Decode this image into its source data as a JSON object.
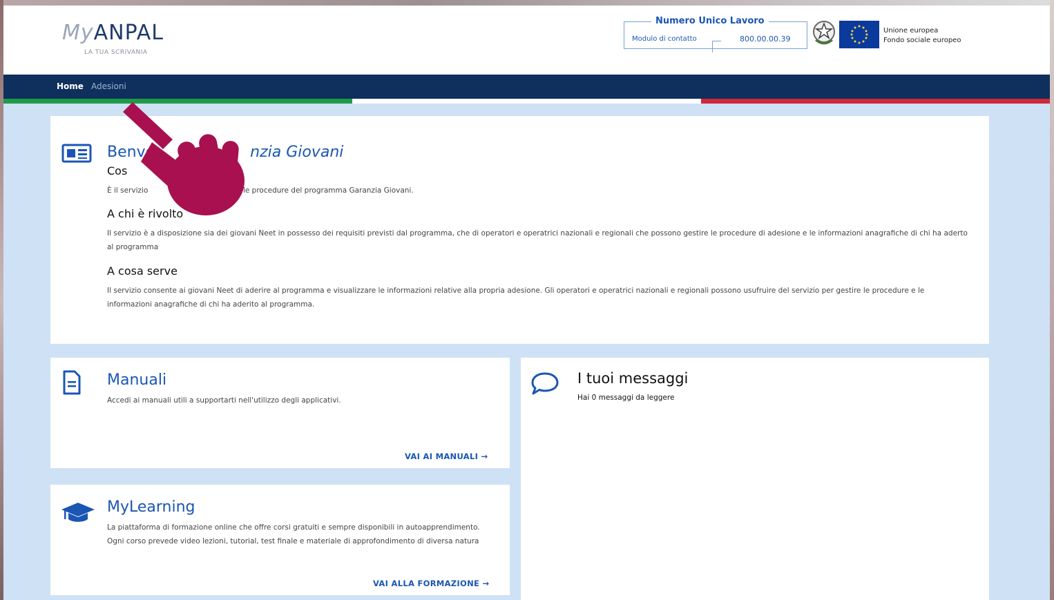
{
  "header": {
    "logo_main": "ANPAL",
    "logo_prefix": "My",
    "logo_subtitle": "LA TUA SCRIVANIA",
    "contact_title": "Numero Unico Lavoro",
    "contact_label": "Modulo di contatto",
    "contact_number": "800.00.00.39",
    "eu_line1": "Unione europea",
    "eu_line2": "Fondo sociale europeo"
  },
  "nav": {
    "home": "Home",
    "adesioni": "Adesioni"
  },
  "colors": {
    "navy": "#0f2f5c",
    "accent_blue": "#1a56b3",
    "background": "#cfe1f5",
    "flag_green": "#1f9a48",
    "flag_white": "#ffffff",
    "flag_red": "#d1283a",
    "cursor_hand": "#a8104f"
  },
  "welcome": {
    "title_visible_start": "Benve",
    "title_visible_end": "nzia Giovani",
    "section1_heading_visible": "Cos",
    "section1_text_start": "È il servizio",
    "section1_text_end": "zioni e le procedure del programma Garanzia Giovani.",
    "section2_heading": "A chi è rivolto",
    "section2_text": "Il servizio è a disposizione sia dei giovani Neet in possesso dei requisiti previsti dal programma, che di operatori e operatrici nazionali e regionali che possono gestire le procedure di adesione e le informazioni anagrafiche di chi ha aderto al programma",
    "section3_heading": "A cosa serve",
    "section3_text": "Il servizio consente ai giovani Neet di aderire al programma e visualizzare le informazioni relative alla propria adesione. Gli operatori e operatrici nazionali e regionali possono usufruire del servizio per gestire le procedure e le informazioni anagrafiche di chi ha aderito al programma."
  },
  "manuali": {
    "title": "Manuali",
    "text": "Accedi ai manuali utili a supportarti nell'utilizzo degli applicativi.",
    "cta": "VAI AI MANUALI →"
  },
  "messaggi": {
    "title": "I tuoi messaggi",
    "text": "Hai 0 messaggi da leggere"
  },
  "mylearning": {
    "title": "MyLearning",
    "text_line1": "La piattaforma di formazione online che offre corsi gratuiti e sempre disponibili in autoapprendimento.",
    "text_line2": "Ogni corso prevede video lezioni, tutorial, test finale e materiale di approfondimento di diversa natura",
    "cta": "VAI ALLA FORMAZIONE →"
  },
  "icons": {
    "welcome": "newspaper-icon",
    "manuali": "document-icon",
    "messaggi": "speech-bubble-icon",
    "mylearning": "graduation-cap-icon",
    "pointer": "pointing-hand-icon"
  }
}
